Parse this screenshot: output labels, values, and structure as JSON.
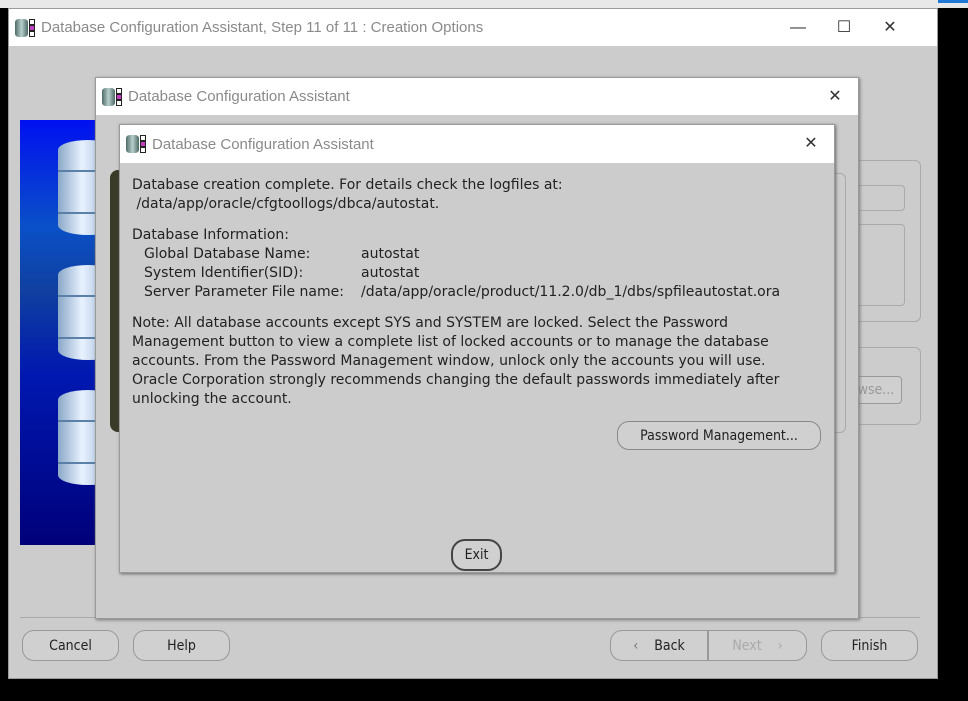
{
  "main_window": {
    "title": "Database Configuration Assistant, Step 11 of 11 : Creation Options",
    "controls": {
      "minimize": "—",
      "maximize": "☐",
      "close": "✕"
    },
    "partial_browse_label": "wse...",
    "buttons": {
      "cancel": "Cancel",
      "help": "Help",
      "back": "Back",
      "next": "Next",
      "finish": "Finish"
    }
  },
  "progress_dialog": {
    "title": "Database Configuration Assistant",
    "close": "✕"
  },
  "completion_dialog": {
    "title": "Database Configuration Assistant",
    "close": "✕",
    "line1": "Database creation complete. For details check the logfiles at:",
    "line2": " /data/app/oracle/cfgtoollogs/dbca/autostat.",
    "info_heading": "Database Information:",
    "info": [
      {
        "label": "Global Database Name:",
        "value": "autostat"
      },
      {
        "label": "System Identifier(SID):",
        "value": "autostat"
      },
      {
        "label": "Server Parameter File name:",
        "value": "/data/app/oracle/product/11.2.0/db_1/dbs/spfileautostat.ora"
      }
    ],
    "note": [
      "Note: All database accounts except SYS and SYSTEM are locked. Select the Password",
      "Management button to view a complete list of locked accounts or to manage the database",
      "accounts. From the Password Management window, unlock only the accounts you will use.",
      "Oracle Corporation strongly recommends changing the default passwords immediately after",
      "unlocking the account."
    ],
    "password_button": "Password Management...",
    "exit_button": "Exit"
  }
}
